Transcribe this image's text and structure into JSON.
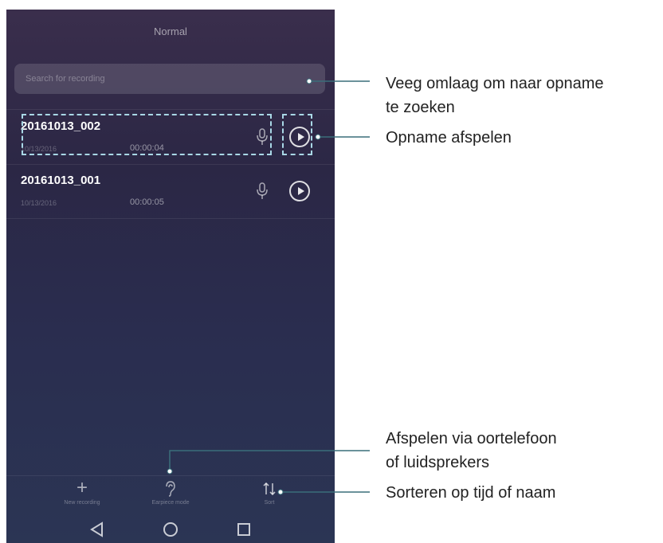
{
  "app": {
    "title": "Normal"
  },
  "search": {
    "placeholder": "Search for recording"
  },
  "recordings": [
    {
      "name": "20161013_002",
      "date": "10/13/2016",
      "duration": "00:00:04"
    },
    {
      "name": "20161013_001",
      "date": "10/13/2016",
      "duration": "00:00:05"
    }
  ],
  "toolbar": {
    "new_label": "New recording",
    "earpiece_label": "Earpiece mode",
    "sort_label": "Sort"
  },
  "icons": {
    "new": "plus-icon",
    "earpiece": "ear-icon",
    "sort": "sort-icon",
    "mic": "microphone-icon",
    "play": "play-icon",
    "back": "back-triangle-icon",
    "home": "home-circle-icon",
    "recents": "recents-square-icon"
  },
  "callouts": {
    "search_line1": "Veeg omlaag om naar opname",
    "search_line2": "te zoeken",
    "play": "Opname afspelen",
    "earpiece_line1": "Afspelen via oortelefoon",
    "earpiece_line2": "of luidsprekers",
    "sort": "Sorteren op tijd of naam"
  },
  "colors": {
    "highlight": "#a9d8e6",
    "callout_line": "#3a6e7a"
  }
}
